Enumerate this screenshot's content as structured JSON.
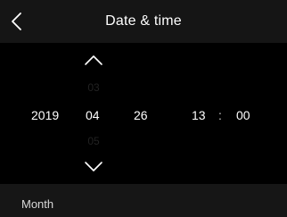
{
  "header": {
    "back_icon": "chevron-left-icon",
    "title": "Date & time"
  },
  "picker": {
    "year": "2019",
    "month": {
      "previous": "03",
      "selected": "04",
      "next": "05",
      "up_icon": "chevron-up-icon",
      "down_icon": "chevron-down-icon"
    },
    "day": "26",
    "hour": "13",
    "separator": ":",
    "minute": "00"
  },
  "footer": {
    "label": "Month"
  },
  "colors": {
    "background": "#000000",
    "header_bg": "#151515",
    "footer_bg": "#161616",
    "text": "#ffffff",
    "faded_text": "#222222"
  }
}
